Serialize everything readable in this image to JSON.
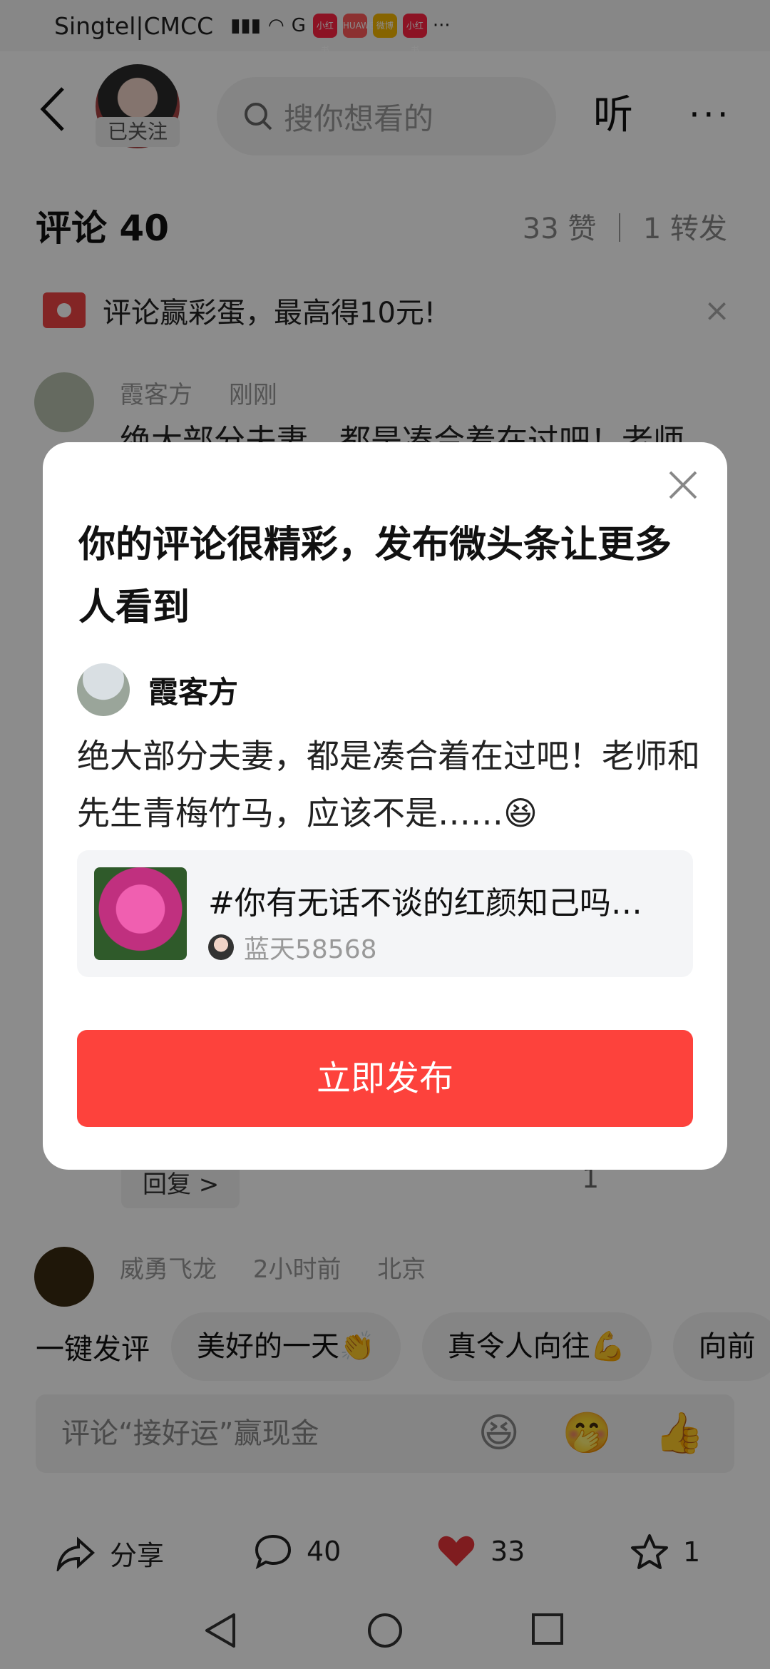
{
  "status_bar": {
    "carrier": "Singtel|CMCC",
    "app_icons": [
      "小红书",
      "HUAWEI",
      "微博",
      "小红书"
    ],
    "more": "···"
  },
  "top_bar": {
    "followed_badge": "已关注",
    "search_placeholder": "搜你想看的",
    "listen_label": "听",
    "more_label": "···"
  },
  "comments": {
    "heading": "评论 40",
    "stats": "33 赞 ｜ 1 转发",
    "banner_text": "评论赢彩蛋，最高得10元!",
    "items": [
      {
        "author": "霞客方",
        "time": "刚刚",
        "text": "绝大部分夫妻，都是凑合着在过吧！老师"
      },
      {
        "author": "威勇飞龙",
        "time": "2小时前",
        "location": "北京"
      }
    ],
    "reply_label": "回复 >",
    "reply_likes": "1"
  },
  "quick_replies": {
    "label": "一键发评",
    "chips": [
      "美好的一天👏",
      "真令人向往💪",
      "向前"
    ]
  },
  "input": {
    "placeholder": "评论“接好运”赢现金",
    "emojis": [
      "😆",
      "🤭",
      "👍"
    ]
  },
  "actions": {
    "share_label": "分享",
    "comment_count": "40",
    "like_count": "33",
    "favorite_count": "1"
  },
  "dialog": {
    "title": "你的评论很精彩，发布微头条让更多人看到",
    "user_name": "霞客方",
    "comment_text": "绝大部分夫妻，都是凑合着在过吧！老师和先生青梅竹马，应该不是……",
    "comment_emoji": "😆",
    "card_title": "#你有无话不谈的红颜知己吗…",
    "card_author": "蓝天58568",
    "publish_label": "立即发布"
  },
  "colors": {
    "accent": "#fd423c",
    "like": "#e8343a"
  }
}
